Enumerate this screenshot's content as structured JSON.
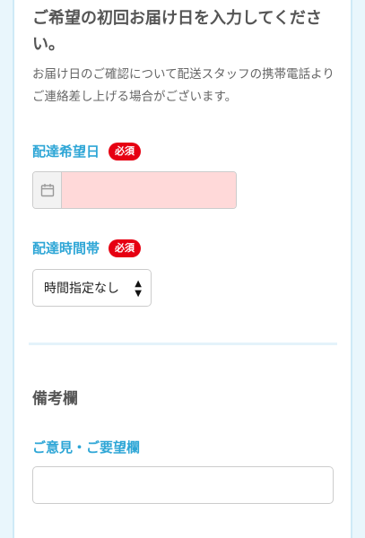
{
  "delivery": {
    "heading": "ご希望の初回お届け日を入力してください。",
    "description": "お届け日のご確認について配送スタッフの携帯電話よりご連絡差し上げる場合がございます。",
    "date_label": "配達希望日",
    "date_badge": "必須",
    "date_value": "",
    "time_label": "配達時間帯",
    "time_badge": "必須",
    "time_selected": "時間指定なし"
  },
  "remarks": {
    "heading": "備考欄",
    "opinion_label": "ご意見・ご要望欄",
    "opinion_value": ""
  },
  "icons": {
    "date": "calendar-icon",
    "select": "updown-arrows-icon"
  },
  "colors": {
    "label": "#2ea6d6",
    "badge": "#e60012",
    "date_field_bg": "#ffd9d9",
    "page_bg": "#e9f6fc"
  }
}
